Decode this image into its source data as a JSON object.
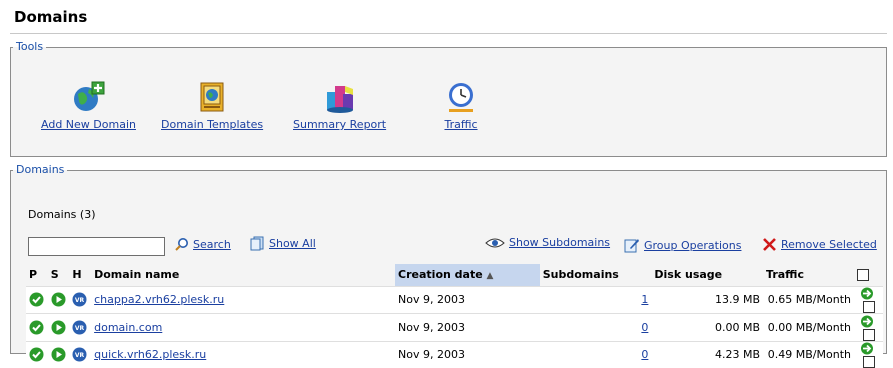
{
  "page": {
    "title": "Domains"
  },
  "tools": {
    "legend": "Tools",
    "items": [
      {
        "label": "Add New Domain",
        "icon": "globe-add-icon"
      },
      {
        "label": "Domain Templates",
        "icon": "template-icon"
      },
      {
        "label": "Summary Report",
        "icon": "report-icon"
      },
      {
        "label": "Traffic",
        "icon": "clock-icon"
      }
    ]
  },
  "domains": {
    "legend": "Domains",
    "count_label": "Domains (3)",
    "search": {
      "value": "",
      "button": "Search",
      "show_all": "Show All"
    },
    "actions": {
      "show_subdomains": "Show Subdomains",
      "group_operations": "Group Operations",
      "remove_selected": "Remove Selected"
    },
    "columns": {
      "p": "P",
      "s": "S",
      "h": "H",
      "name": "Domain name",
      "created": "Creation date",
      "subdomains": "Subdomains",
      "disk": "Disk usage",
      "traffic": "Traffic"
    },
    "sort_indicator": "▲",
    "rows": [
      {
        "name": "chappa2.vrh62.plesk.ru",
        "created": "Nov 9, 2003",
        "subdomains": "1",
        "disk": "13.9 MB",
        "traffic": "0.65 MB/Month"
      },
      {
        "name": "domain.com",
        "created": "Nov 9, 2003",
        "subdomains": "0",
        "disk": "0.00 MB",
        "traffic": "0.00 MB/Month"
      },
      {
        "name": "quick.vrh62.plesk.ru",
        "created": "Nov 9, 2003",
        "subdomains": "0",
        "disk": "4.23 MB",
        "traffic": "0.49 MB/Month"
      }
    ],
    "colors": {
      "status_green": "#2a9a2a",
      "link": "#1a3fa0",
      "sorted_header": "#c6d6ee"
    }
  }
}
